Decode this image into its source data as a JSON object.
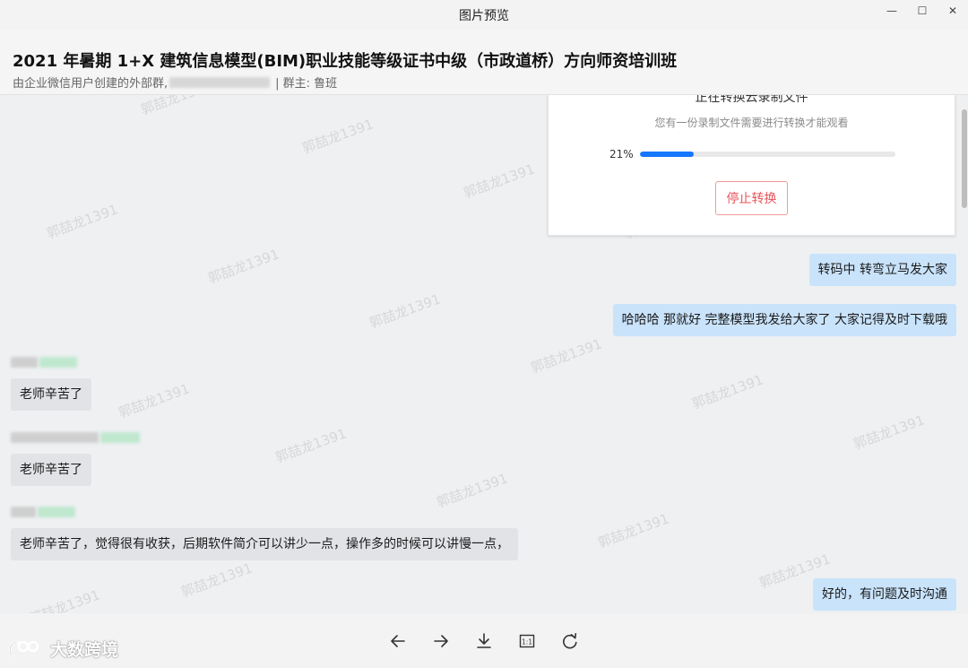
{
  "window": {
    "title": "图片预览",
    "controls": {
      "minimize": "—",
      "maximize": "☐",
      "close": "✕"
    }
  },
  "header": {
    "group_title": "2021 年暑期 1+X 建筑信息模型(BIM)职业技能等级证书中级（市政道桥）方向师资培训班",
    "subtitle_prefix": "由企业微信用户创建的外部群,",
    "subtitle_suffix": "| 群主: 鲁班"
  },
  "image_card": {
    "title": "正在转换云录制文件",
    "description": "您有一份录制文件需要进行转换才能观看",
    "progress_label": "21%",
    "progress_value": 0.21,
    "stop_button": "停止转换"
  },
  "messages": [
    {
      "direction": "out",
      "text": "转码中  转弯立马发大家"
    },
    {
      "direction": "out",
      "text": "哈哈哈  那就好  完整模型我发给大家了   大家记得及时下载哦"
    },
    {
      "direction": "in",
      "text": "老师辛苦了"
    },
    {
      "direction": "in",
      "text": "老师辛苦了"
    },
    {
      "direction": "in",
      "text": "老师辛苦了，觉得很有收获，后期软件简介可以讲少一点，操作多的时候可以讲慢一点，"
    },
    {
      "direction": "out",
      "text": "好的，有问题及时沟通"
    }
  ],
  "watermark_text": "郭喆龙1391",
  "toolbar": {
    "icons": [
      "arrow-left-icon",
      "arrow-right-icon",
      "download-icon",
      "actual-size-icon",
      "rotate-icon"
    ],
    "actual_size_label": "1:1"
  },
  "logo": {
    "text": "大数跨境"
  },
  "colors": {
    "outgoing_bubble": "#c9e3fb",
    "incoming_bubble": "#e1e3e6",
    "progress": "#1677ff",
    "stop_button": "#e8535a"
  }
}
